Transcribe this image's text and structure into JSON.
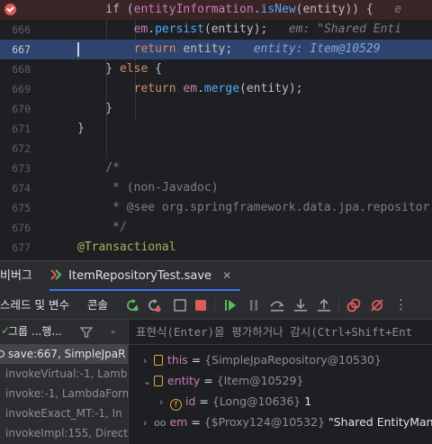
{
  "editor": {
    "lines": [
      {
        "num": "",
        "breakpoint": true,
        "tokens": [
          [
            "",
            "    if ("
          ],
          [
            "fld",
            "entityInformation"
          ],
          [
            "",
            "."
          ],
          [
            "fn",
            "isNew"
          ],
          [
            "",
            "(entity)) {   "
          ],
          [
            "inl",
            "e"
          ]
        ]
      },
      {
        "num": "666",
        "tokens": [
          [
            "fld",
            "        em"
          ],
          [
            "",
            "."
          ],
          [
            "fn",
            "persist"
          ],
          [
            "",
            "(entity);   "
          ],
          [
            "inl",
            "em: \"Shared Enti"
          ]
        ]
      },
      {
        "num": "667",
        "current": true,
        "tokens": [
          [
            "kw",
            "        return "
          ],
          [
            "",
            "entity;   "
          ],
          [
            "inlb",
            "entity: Item@10529"
          ]
        ]
      },
      {
        "num": "668",
        "tokens": [
          [
            "",
            "    } "
          ],
          [
            "kw",
            "else"
          ],
          [
            "",
            " {"
          ]
        ]
      },
      {
        "num": "669",
        "tokens": [
          [
            "kw",
            "        return "
          ],
          [
            "fld",
            "em"
          ],
          [
            "",
            "."
          ],
          [
            "fn",
            "merge"
          ],
          [
            "",
            "(entity);"
          ]
        ]
      },
      {
        "num": "670",
        "tokens": [
          [
            "",
            "    }"
          ]
        ]
      },
      {
        "num": "671",
        "tokens": [
          [
            "",
            "}"
          ]
        ]
      },
      {
        "num": "672",
        "tokens": []
      },
      {
        "num": "673",
        "tokens": [
          [
            "cm",
            "    /*"
          ]
        ]
      },
      {
        "num": "674",
        "tokens": [
          [
            "cm",
            "     * (non-Javadoc)"
          ]
        ]
      },
      {
        "num": "675",
        "tokens": [
          [
            "cm",
            "     * @see org.springframework.data.jpa.repositor"
          ]
        ]
      },
      {
        "num": "676",
        "tokens": [
          [
            "cm",
            "     */"
          ]
        ]
      },
      {
        "num": "677",
        "tokens": [
          [
            "ann",
            "@Transactional"
          ]
        ]
      }
    ]
  },
  "tabs": {
    "left_tab": "비버그",
    "config_tab": "ItemRepositoryTest.save"
  },
  "toolbar": {
    "threads_label": "스레드 및 변수",
    "console_label": "콘솔"
  },
  "threads": {
    "group_label": "그룹 ...행...",
    "frames": [
      {
        "text": "save:667, SimpleJpaR",
        "selected": true
      },
      {
        "text": "invokeVirtual:-1, Lamb"
      },
      {
        "text": "invoke:-1, LambdaForm"
      },
      {
        "text": "invokeExact_MT:-1, In"
      },
      {
        "text": "invokeImpl:155, Direct"
      }
    ]
  },
  "variables": {
    "expr_placeholder": "표현식(Enter)을 평가하거나 감시(Ctrl+Shift+Ent",
    "items": [
      {
        "name": "this",
        "value": "{SimpleJpaRepository@10530}",
        "icon": "stack-icon"
      },
      {
        "name": "entity",
        "value": "{Item@10529}",
        "icon": "stack-icon",
        "expanded": true
      },
      {
        "name": "id",
        "type": "{Long@10636}",
        "value": "1",
        "icon": "field-icon"
      },
      {
        "name": "em",
        "type": "{$Proxy124@10532}",
        "value": "\"Shared EntityMana",
        "icon": "watch-icon"
      }
    ]
  }
}
